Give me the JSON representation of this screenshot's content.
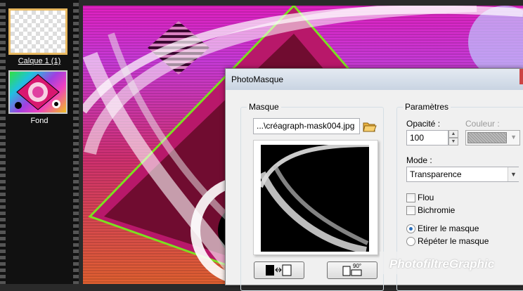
{
  "layers": {
    "items": [
      {
        "label": "Calque 1 (1)"
      },
      {
        "label": "Fond"
      }
    ]
  },
  "dialog": {
    "title": "PhotoMasque",
    "mask_group": {
      "label": "Masque",
      "file_value": "...\\créagraph-mask004.jpg",
      "folder_icon": "open-folder-icon",
      "invert_icon": "invert-mask-icon",
      "rotate_label": "90°",
      "rotate_icon": "rotate-flip-icon"
    },
    "params_group": {
      "label": "Paramètres",
      "opacity_label": "Opacité :",
      "opacity_value": "100",
      "color_label": "Couleur :",
      "mode_label": "Mode :",
      "mode_value": "Transparence",
      "checkboxes": [
        {
          "label": "Flou",
          "checked": false
        },
        {
          "label": "Bichromie",
          "checked": false
        }
      ],
      "radios": [
        {
          "label": "Etirer le masque",
          "selected": true
        },
        {
          "label": "Répéter le masque",
          "selected": false
        }
      ]
    }
  },
  "watermark": "PhotofiltreGraphic",
  "colors": {
    "canvas_magenta": "#e020c0",
    "accent_green": "#7ce020",
    "selection_border": "#e8b860"
  }
}
